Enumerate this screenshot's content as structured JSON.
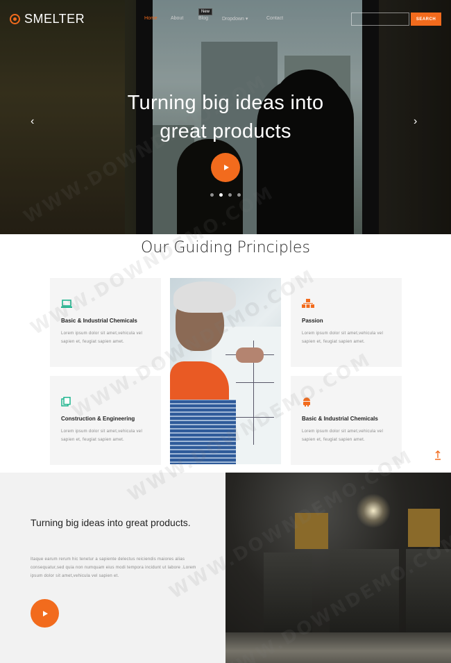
{
  "brand": {
    "name": "SMELTER",
    "accent": "#f26b1d"
  },
  "nav": {
    "items": [
      {
        "label": "Home",
        "active": true
      },
      {
        "label": "About",
        "active": false
      },
      {
        "label": "Blog",
        "active": false
      },
      {
        "label": "Dropdown ▾",
        "active": false
      },
      {
        "label": "Contact",
        "active": false
      }
    ],
    "badge": "New",
    "search_placeholder": "",
    "search_button": "SEARCH"
  },
  "hero": {
    "title_line1": "Turning big ideas into",
    "title_line2": "great products",
    "prev_arrow": "‹",
    "next_arrow": "›",
    "slides": 4,
    "active_slide": 2
  },
  "principles": {
    "title": "Our Guiding Principles",
    "cards": [
      {
        "icon": "laptop-icon",
        "color": "#1fb58f",
        "title": "Basic & Industrial Chemicals",
        "text": "Lorem ipsum dolor sit amet,vehicula vel sapien et, feugiat sapien amet."
      },
      {
        "icon": "sitemap-icon",
        "color": "#f26b1d",
        "title": "Passion",
        "text": "Lorem ipsum dolor sit amet,vehicula vel sapien et, feugiat sapien amet."
      },
      {
        "icon": "copy-icon",
        "color": "#1fb58f",
        "title": "Construction & Engineering",
        "text": "Lorem ipsum dolor sit amet,vehicula vel sapien et, feugiat sapien amet."
      },
      {
        "icon": "android-icon",
        "color": "#f26b1d",
        "title": "Basic & Industrial Chemicals",
        "text": "Lorem ipsum dolor sit amet,vehicula vel sapien et, feugiat sapien amet."
      }
    ]
  },
  "feature": {
    "title": "Turning big ideas into great products.",
    "text": "Itaque earum rerum hic tenetur a sapiente delectus reiciendis maiores alias consequatur,sed quia non numquam eius modi tempora incidunt ut labore .Lorem ipsum dolor sit amet,vehicula vel sapien et."
  },
  "watermark": "WWW.DOWNDEMO.COM"
}
